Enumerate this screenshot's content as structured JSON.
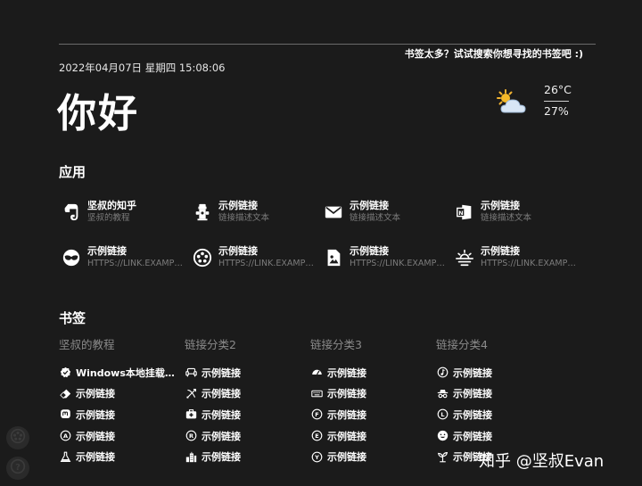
{
  "search": {
    "hint": "书签太多？试试搜索你想寻找的书签吧 :)"
  },
  "header": {
    "datetime": "2022年04月07日 星期四 15:08:06",
    "greeting": "你好"
  },
  "weather": {
    "temperature": "26°C",
    "humidity": "27%",
    "icon": "partly-cloudy-icon"
  },
  "apps": {
    "title": "应用",
    "items": [
      {
        "name": "坚叔的知乎",
        "desc": "坚叔的教程",
        "icon": "evernote-icon"
      },
      {
        "name": "示例链接",
        "desc": "链接描述文本",
        "icon": "fire-hydrant-icon"
      },
      {
        "name": "示例链接",
        "desc": "链接描述文本",
        "icon": "mail-icon"
      },
      {
        "name": "示例链接",
        "desc": "链接描述文本",
        "icon": "office-icon"
      },
      {
        "name": "示例链接",
        "desc": "HTTPS://LINK.EXAMPLE.COM",
        "icon": "mask-icon"
      },
      {
        "name": "示例链接",
        "desc": "HTTPS://LINK.EXAMPLE.COM",
        "icon": "film-reel-icon"
      },
      {
        "name": "示例链接",
        "desc": "HTTPS://LINK.EXAMPLE.COM",
        "icon": "image-file-icon"
      },
      {
        "name": "示例链接",
        "desc": "HTTPS://LINK.EXAMPLE.COM",
        "icon": "sunset-icon"
      }
    ]
  },
  "bookmarks": {
    "title": "书签",
    "columns": [
      {
        "title": "坚叔的教程",
        "items": [
          {
            "label": "Windows本地挂载群晖",
            "icon": "verified-badge-icon"
          },
          {
            "label": "示例链接",
            "icon": "eraser-icon"
          },
          {
            "label": "示例链接",
            "icon": "mastodon-icon"
          },
          {
            "label": "示例链接",
            "icon": "letter-a-circle-icon"
          },
          {
            "label": "示例链接",
            "icon": "flask-icon"
          }
        ]
      },
      {
        "title": "链接分类2",
        "items": [
          {
            "label": "示例链接",
            "icon": "sofa-icon"
          },
          {
            "label": "示例链接",
            "icon": "archery-icon"
          },
          {
            "label": "示例链接",
            "icon": "first-aid-icon"
          },
          {
            "label": "示例链接",
            "icon": "letter-r-circle-icon"
          },
          {
            "label": "示例链接",
            "icon": "city-icon"
          }
        ]
      },
      {
        "title": "链接分类3",
        "items": [
          {
            "label": "示例链接",
            "icon": "gauge-icon"
          },
          {
            "label": "示例链接",
            "icon": "keyboard-icon"
          },
          {
            "label": "示例链接",
            "icon": "letter-f-circle-icon"
          },
          {
            "label": "示例链接",
            "icon": "letter-e-circle-icon"
          },
          {
            "label": "示例链接",
            "icon": "letter-y-circle-icon"
          }
        ]
      },
      {
        "title": "链接分类4",
        "items": [
          {
            "label": "示例链接",
            "icon": "music-note-icon"
          },
          {
            "label": "示例链接",
            "icon": "incognito-icon"
          },
          {
            "label": "示例链接",
            "icon": "letter-l-circle-icon"
          },
          {
            "label": "示例链接",
            "icon": "smiley-icon"
          },
          {
            "label": "示例链接",
            "icon": "seedling-icon"
          }
        ]
      }
    ]
  },
  "corner": {
    "top_icon": "film-reel-icon",
    "bottom_icon": "help-icon"
  },
  "watermark": "知乎 @坚叔Evan"
}
